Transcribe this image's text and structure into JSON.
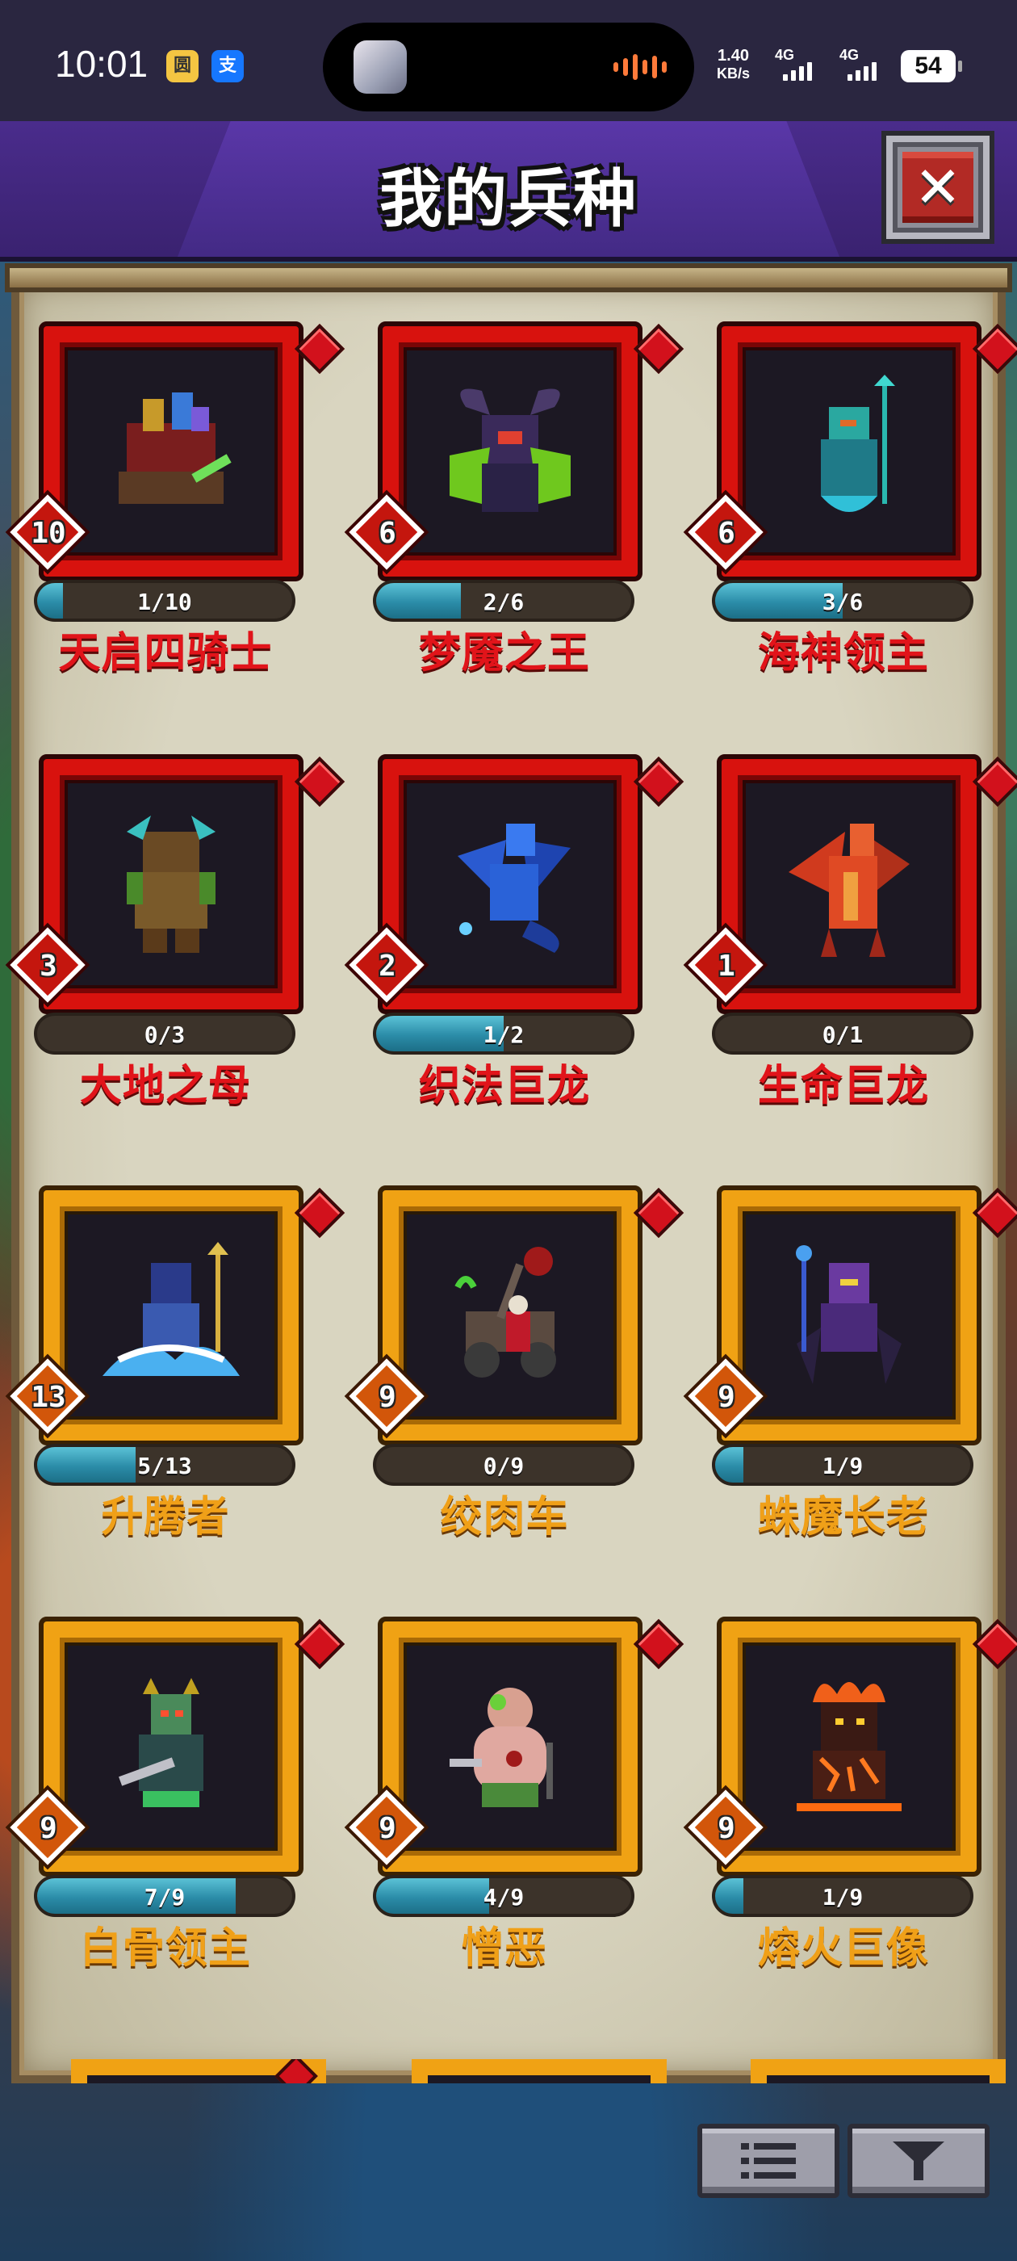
{
  "status_bar": {
    "time": "10:01",
    "app_icons": [
      "圆",
      "支"
    ],
    "network_speed": "1.40",
    "network_unit": "KB/s",
    "signal1": "4G",
    "signal2": "4G",
    "battery": "54"
  },
  "header": {
    "title": "我的兵种",
    "close_icon": "close-icon"
  },
  "units": [
    {
      "name": "天启四骑士",
      "level": "10",
      "progress": "1/10",
      "fill": 0.1,
      "rarity": "red",
      "icon": "four-horsemen-icon",
      "accent": "#d8120e"
    },
    {
      "name": "梦魇之王",
      "level": "6",
      "progress": "2/6",
      "fill": 0.333,
      "rarity": "red",
      "icon": "nightmare-king-icon",
      "accent": "#d8120e"
    },
    {
      "name": "海神领主",
      "level": "6",
      "progress": "3/6",
      "fill": 0.5,
      "rarity": "red",
      "icon": "sea-god-lord-icon",
      "accent": "#d8120e"
    },
    {
      "name": "大地之母",
      "level": "3",
      "progress": "0/3",
      "fill": 0,
      "rarity": "red",
      "icon": "earth-mother-icon",
      "accent": "#d8120e"
    },
    {
      "name": "织法巨龙",
      "level": "2",
      "progress": "1/2",
      "fill": 0.5,
      "rarity": "red",
      "icon": "arcane-dragon-icon",
      "accent": "#d8120e"
    },
    {
      "name": "生命巨龙",
      "level": "1",
      "progress": "0/1",
      "fill": 0,
      "rarity": "red",
      "icon": "life-dragon-icon",
      "accent": "#d8120e"
    },
    {
      "name": "升腾者",
      "level": "13",
      "progress": "5/13",
      "fill": 0.385,
      "rarity": "gold",
      "icon": "ascendant-icon",
      "accent": "#f0a214"
    },
    {
      "name": "绞肉车",
      "level": "9",
      "progress": "0/9",
      "fill": 0,
      "rarity": "gold",
      "icon": "meat-wagon-icon",
      "accent": "#f0a214"
    },
    {
      "name": "蛛魔长老",
      "level": "9",
      "progress": "1/9",
      "fill": 0.111,
      "rarity": "gold",
      "icon": "crypt-elder-icon",
      "accent": "#f0a214"
    },
    {
      "name": "白骨领主",
      "level": "9",
      "progress": "7/9",
      "fill": 0.778,
      "rarity": "gold",
      "icon": "bone-lord-icon",
      "accent": "#f0a214"
    },
    {
      "name": "憎恶",
      "level": "9",
      "progress": "4/9",
      "fill": 0.444,
      "rarity": "gold",
      "icon": "abomination-icon",
      "accent": "#f0a214"
    },
    {
      "name": "熔火巨像",
      "level": "9",
      "progress": "1/9",
      "fill": 0.111,
      "rarity": "gold",
      "icon": "molten-colossus-icon",
      "accent": "#f0a214"
    }
  ],
  "bottom_buttons": [
    {
      "icon": "list-icon"
    },
    {
      "icon": "filter-icon"
    }
  ]
}
